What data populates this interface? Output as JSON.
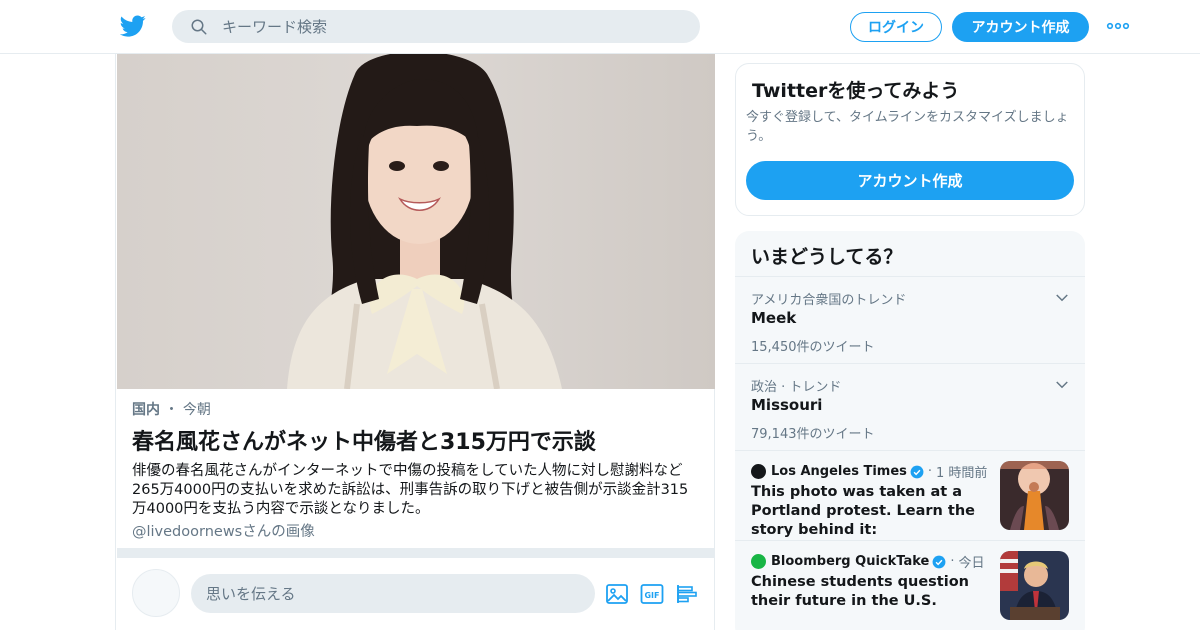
{
  "header": {
    "logo_icon": "twitter-bird-icon",
    "search_placeholder": "キーワード検索",
    "login_label": "ログイン",
    "signup_label": "アカウント作成",
    "more_icon": "more-dots-icon",
    "brand_color": "#1da1f2"
  },
  "moment": {
    "category": "国内",
    "separator": "・",
    "time": "今朝",
    "headline": "春名風花さんがネット中傷者と315万円で示談",
    "description": "俳優の春名風花さんがインターネットで中傷の投稿をしていた人物に対し慰謝料など265万4000円の支払いを求めた訴訟は、刑事告訴の取り下げと被告側が示談金計315万4000円を支払う内容で示談となりました。",
    "credit": "@livedoornewsさんの画像"
  },
  "compose": {
    "placeholder": "思いを伝える",
    "tools": [
      "image-icon",
      "gif-icon",
      "poll-icon"
    ]
  },
  "join_card": {
    "title": "Twitterを使ってみよう",
    "text": "今すぐ登録して、タイムラインをカスタマイズしましょう。",
    "button": "アカウント作成"
  },
  "trends": {
    "title": "いまどうしてる？",
    "items": [
      {
        "context": "アメリカ合衆国のトレンド",
        "name": "Meek",
        "count": "15,450件のツイート"
      },
      {
        "context": "政治 · トレンド",
        "name": "Missouri",
        "count": "79,143件のツイート"
      }
    ],
    "news": [
      {
        "source": "Los Angeles Times",
        "time": "1 時間前",
        "text": "This photo was taken at a Portland protest. Learn the story behind it:"
      },
      {
        "source": "Bloomberg QuickTake",
        "time": "今日",
        "text": "Chinese students question their future in the U.S."
      }
    ]
  }
}
